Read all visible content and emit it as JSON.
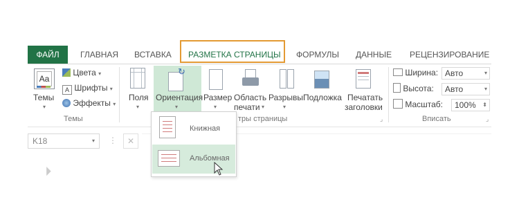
{
  "tabs": {
    "file": "ФАЙЛ",
    "home": "ГЛАВНАЯ",
    "insert": "ВСТАВКА",
    "page_layout": "РАЗМЕТКА СТРАНИЦЫ",
    "formulas": "ФОРМУЛЫ",
    "data": "ДАННЫЕ",
    "review": "РЕЦЕНЗИРОВАНИЕ"
  },
  "themes_group": {
    "themes": "Темы",
    "colors": "Цвета",
    "fonts": "Шрифты",
    "effects": "Эффекты",
    "label": "Темы"
  },
  "page_setup_group": {
    "margins": "Поля",
    "orientation": "Ориентация",
    "size": "Размер",
    "print_area_1": "Область",
    "print_area_2": "печати",
    "breaks": "Разрывы",
    "background": "Подложка",
    "print_titles_1": "Печатать",
    "print_titles_2": "заголовки",
    "label": "тры страницы"
  },
  "scale_group": {
    "width_label": "Ширина:",
    "width_value": "Авто",
    "height_label": "Высота:",
    "height_value": "Авто",
    "scale_label": "Масштаб:",
    "scale_value": "100%",
    "label": "Вписать"
  },
  "formula_bar": {
    "name_box": "K18"
  },
  "orientation_menu": {
    "portrait": "Книжная",
    "landscape": "Альбомная"
  },
  "colors": {
    "accent_green": "#217346",
    "highlight_orange": "#e39a33"
  }
}
